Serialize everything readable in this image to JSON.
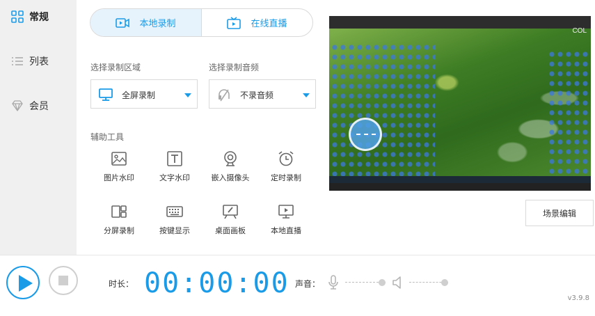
{
  "sidebar": {
    "items": [
      {
        "label": "常规",
        "icon": "grid-icon",
        "active": true
      },
      {
        "label": "列表",
        "icon": "list-icon",
        "active": false
      },
      {
        "label": "会员",
        "icon": "diamond-icon",
        "active": false
      }
    ]
  },
  "mode_tabs": [
    {
      "label": "本地录制",
      "icon": "video-record-icon",
      "active": true
    },
    {
      "label": "在线直播",
      "icon": "tv-live-icon",
      "active": false
    }
  ],
  "record_area": {
    "label": "选择录制区域",
    "value": "全屏录制",
    "icon": "monitor-icon"
  },
  "record_audio": {
    "label": "选择录制音频",
    "value": "不录音频",
    "icon": "mute-icon"
  },
  "tools": {
    "label": "辅助工具",
    "items": [
      {
        "label": "图片水印",
        "icon": "image-icon"
      },
      {
        "label": "文字水印",
        "icon": "text-icon"
      },
      {
        "label": "嵌入摄像头",
        "icon": "webcam-icon"
      },
      {
        "label": "定时录制",
        "icon": "alarm-icon"
      },
      {
        "label": "分屏录制",
        "icon": "split-screen-icon"
      },
      {
        "label": "按键显示",
        "icon": "keyboard-icon"
      },
      {
        "label": "桌面画板",
        "icon": "drawing-board-icon"
      },
      {
        "label": "本地直播",
        "icon": "local-live-icon"
      }
    ]
  },
  "preview": {
    "corner_text": "COL"
  },
  "scene_edit_label": "场景编辑",
  "bottom_bar": {
    "duration_label": "时长：",
    "timer": "00:00:00",
    "sound_label": "声音：",
    "mic_level": 1.0,
    "speaker_level": 1.0
  },
  "version": "v3.9.8",
  "colors": {
    "accent": "#1a9be8",
    "sidebar_bg": "#f0f0f0",
    "tab_active_bg": "#e6f3fd"
  }
}
